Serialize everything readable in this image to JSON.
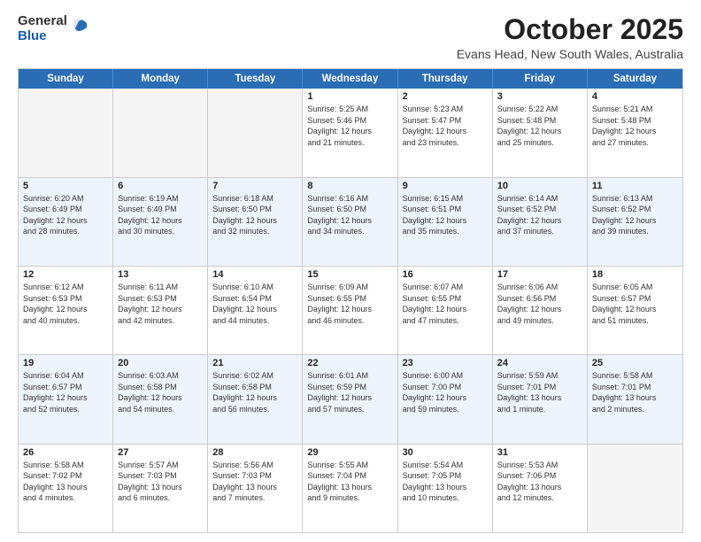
{
  "header": {
    "logo_general": "General",
    "logo_blue": "Blue",
    "month": "October 2025",
    "location": "Evans Head, New South Wales, Australia"
  },
  "days_of_week": [
    "Sunday",
    "Monday",
    "Tuesday",
    "Wednesday",
    "Thursday",
    "Friday",
    "Saturday"
  ],
  "rows": [
    [
      {
        "day": "",
        "content": ""
      },
      {
        "day": "",
        "content": ""
      },
      {
        "day": "",
        "content": ""
      },
      {
        "day": "1",
        "content": "Sunrise: 5:25 AM\nSunset: 5:46 PM\nDaylight: 12 hours\nand 21 minutes."
      },
      {
        "day": "2",
        "content": "Sunrise: 5:23 AM\nSunset: 5:47 PM\nDaylight: 12 hours\nand 23 minutes."
      },
      {
        "day": "3",
        "content": "Sunrise: 5:22 AM\nSunset: 5:48 PM\nDaylight: 12 hours\nand 25 minutes."
      },
      {
        "day": "4",
        "content": "Sunrise: 5:21 AM\nSunset: 5:48 PM\nDaylight: 12 hours\nand 27 minutes."
      }
    ],
    [
      {
        "day": "5",
        "content": "Sunrise: 6:20 AM\nSunset: 6:49 PM\nDaylight: 12 hours\nand 28 minutes."
      },
      {
        "day": "6",
        "content": "Sunrise: 6:19 AM\nSunset: 6:49 PM\nDaylight: 12 hours\nand 30 minutes."
      },
      {
        "day": "7",
        "content": "Sunrise: 6:18 AM\nSunset: 6:50 PM\nDaylight: 12 hours\nand 32 minutes."
      },
      {
        "day": "8",
        "content": "Sunrise: 6:16 AM\nSunset: 6:50 PM\nDaylight: 12 hours\nand 34 minutes."
      },
      {
        "day": "9",
        "content": "Sunrise: 6:15 AM\nSunset: 6:51 PM\nDaylight: 12 hours\nand 35 minutes."
      },
      {
        "day": "10",
        "content": "Sunrise: 6:14 AM\nSunset: 6:52 PM\nDaylight: 12 hours\nand 37 minutes."
      },
      {
        "day": "11",
        "content": "Sunrise: 6:13 AM\nSunset: 6:52 PM\nDaylight: 12 hours\nand 39 minutes."
      }
    ],
    [
      {
        "day": "12",
        "content": "Sunrise: 6:12 AM\nSunset: 6:53 PM\nDaylight: 12 hours\nand 40 minutes."
      },
      {
        "day": "13",
        "content": "Sunrise: 6:11 AM\nSunset: 6:53 PM\nDaylight: 12 hours\nand 42 minutes."
      },
      {
        "day": "14",
        "content": "Sunrise: 6:10 AM\nSunset: 6:54 PM\nDaylight: 12 hours\nand 44 minutes."
      },
      {
        "day": "15",
        "content": "Sunrise: 6:09 AM\nSunset: 6:55 PM\nDaylight: 12 hours\nand 46 minutes."
      },
      {
        "day": "16",
        "content": "Sunrise: 6:07 AM\nSunset: 6:55 PM\nDaylight: 12 hours\nand 47 minutes."
      },
      {
        "day": "17",
        "content": "Sunrise: 6:06 AM\nSunset: 6:56 PM\nDaylight: 12 hours\nand 49 minutes."
      },
      {
        "day": "18",
        "content": "Sunrise: 6:05 AM\nSunset: 6:57 PM\nDaylight: 12 hours\nand 51 minutes."
      }
    ],
    [
      {
        "day": "19",
        "content": "Sunrise: 6:04 AM\nSunset: 6:57 PM\nDaylight: 12 hours\nand 52 minutes."
      },
      {
        "day": "20",
        "content": "Sunrise: 6:03 AM\nSunset: 6:58 PM\nDaylight: 12 hours\nand 54 minutes."
      },
      {
        "day": "21",
        "content": "Sunrise: 6:02 AM\nSunset: 6:58 PM\nDaylight: 12 hours\nand 56 minutes."
      },
      {
        "day": "22",
        "content": "Sunrise: 6:01 AM\nSunset: 6:59 PM\nDaylight: 12 hours\nand 57 minutes."
      },
      {
        "day": "23",
        "content": "Sunrise: 6:00 AM\nSunset: 7:00 PM\nDaylight: 12 hours\nand 59 minutes."
      },
      {
        "day": "24",
        "content": "Sunrise: 5:59 AM\nSunset: 7:01 PM\nDaylight: 13 hours\nand 1 minute."
      },
      {
        "day": "25",
        "content": "Sunrise: 5:58 AM\nSunset: 7:01 PM\nDaylight: 13 hours\nand 2 minutes."
      }
    ],
    [
      {
        "day": "26",
        "content": "Sunrise: 5:58 AM\nSunset: 7:02 PM\nDaylight: 13 hours\nand 4 minutes."
      },
      {
        "day": "27",
        "content": "Sunrise: 5:57 AM\nSunset: 7:03 PM\nDaylight: 13 hours\nand 6 minutes."
      },
      {
        "day": "28",
        "content": "Sunrise: 5:56 AM\nSunset: 7:03 PM\nDaylight: 13 hours\nand 7 minutes."
      },
      {
        "day": "29",
        "content": "Sunrise: 5:55 AM\nSunset: 7:04 PM\nDaylight: 13 hours\nand 9 minutes."
      },
      {
        "day": "30",
        "content": "Sunrise: 5:54 AM\nSunset: 7:05 PM\nDaylight: 13 hours\nand 10 minutes."
      },
      {
        "day": "31",
        "content": "Sunrise: 5:53 AM\nSunset: 7:06 PM\nDaylight: 13 hours\nand 12 minutes."
      },
      {
        "day": "",
        "content": ""
      }
    ]
  ]
}
